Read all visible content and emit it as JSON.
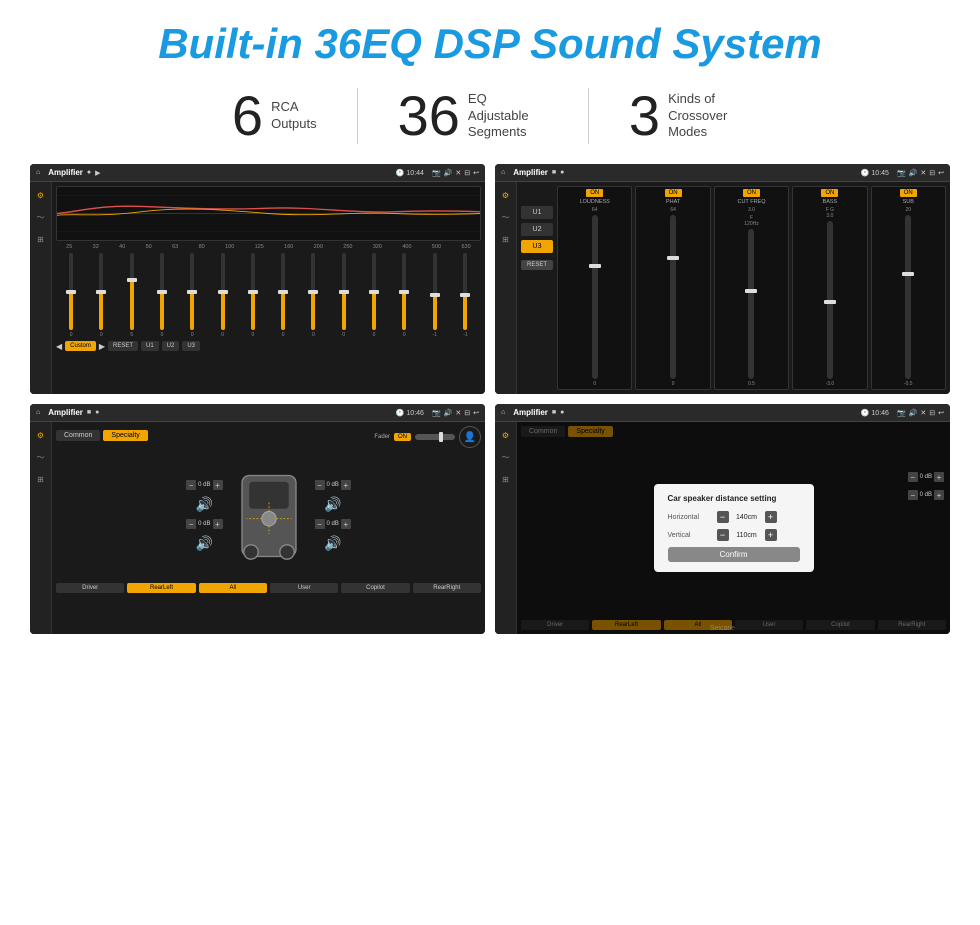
{
  "page": {
    "title": "Built-in 36EQ DSP Sound System",
    "stats": [
      {
        "number": "6",
        "label": "RCA\nOutputs"
      },
      {
        "number": "36",
        "label": "EQ Adjustable\nSegments"
      },
      {
        "number": "3",
        "label": "Kinds of\nCrossover Modes"
      }
    ],
    "screens": [
      {
        "id": "screen1",
        "title": "Amplifier",
        "time": "10:44",
        "type": "eq_main"
      },
      {
        "id": "screen2",
        "title": "Amplifier",
        "time": "10:45",
        "type": "eq_channels"
      },
      {
        "id": "screen3",
        "title": "Amplifier",
        "time": "10:46",
        "type": "speaker_config"
      },
      {
        "id": "screen4",
        "title": "Amplifier",
        "time": "10:46",
        "type": "distance_dialog"
      }
    ],
    "eq_labels": [
      "25",
      "32",
      "40",
      "50",
      "63",
      "80",
      "100",
      "125",
      "160",
      "200",
      "250",
      "320",
      "400",
      "500",
      "630"
    ],
    "eq_values": [
      "0",
      "0",
      "5",
      "0",
      "0",
      "0",
      "0",
      "0",
      "0",
      "0",
      "0",
      "0",
      "-1",
      "-1"
    ],
    "channels": [
      "LOUDNESS",
      "PHAT",
      "CUT FREQ",
      "BASS",
      "SUB"
    ],
    "channel_on": [
      true,
      true,
      true,
      true,
      true
    ],
    "u_buttons": [
      "U1",
      "U2",
      "U3"
    ],
    "speaker_tabs": [
      "Common",
      "Specialty"
    ],
    "speaker_buttons": [
      "Driver",
      "RearLeft",
      "All",
      "User",
      "Copilot",
      "RearRight"
    ],
    "dialog": {
      "title": "Car speaker distance setting",
      "horizontal_label": "Horizontal",
      "horizontal_value": "140cm",
      "vertical_label": "Vertical",
      "vertical_value": "110cm",
      "confirm_label": "Confirm"
    },
    "fader_label": "Fader",
    "reset_label": "RESET",
    "custom_label": "Custom"
  }
}
